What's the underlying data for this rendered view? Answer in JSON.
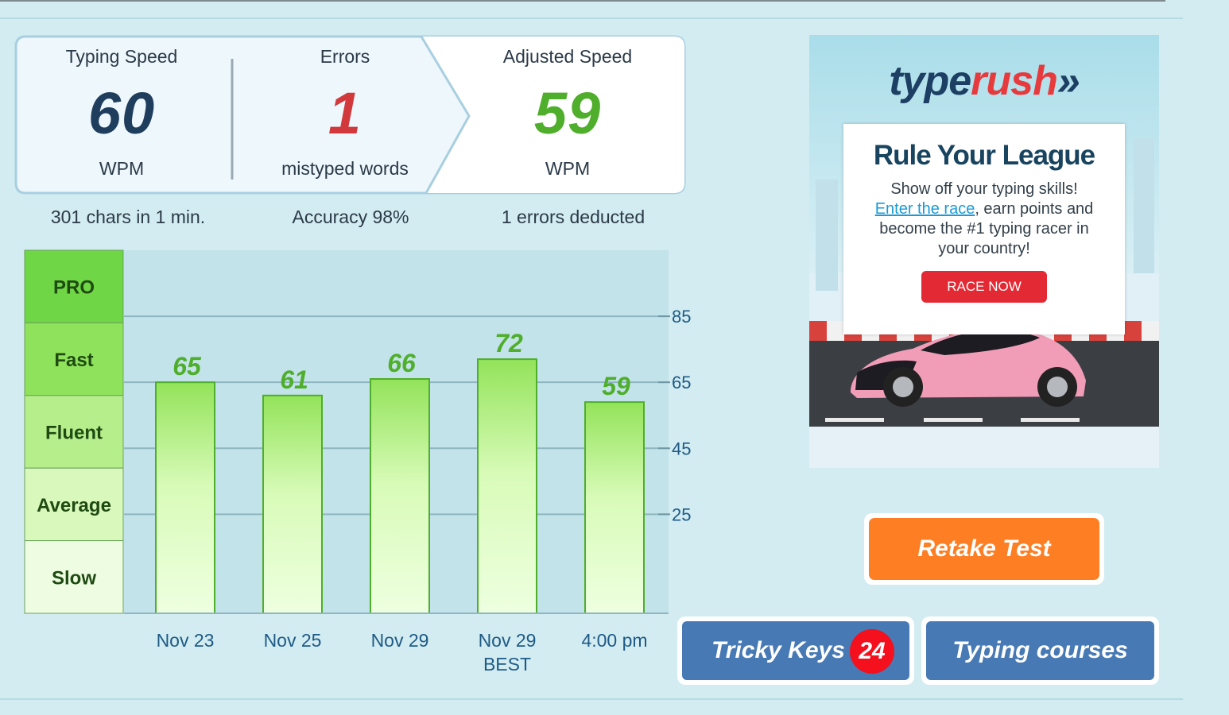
{
  "stats": {
    "typing_speed": {
      "label": "Typing Speed",
      "value": "60",
      "unit": "WPM",
      "color": "#1f3d5c"
    },
    "errors": {
      "label": "Errors",
      "value": "1",
      "unit": "mistyped words",
      "color": "#d1393d"
    },
    "adjusted_speed": {
      "label": "Adjusted Speed",
      "value": "59",
      "unit": "WPM",
      "color": "#4fae2b"
    }
  },
  "summary": {
    "chars": "301 chars in 1 min.",
    "accuracy": "Accuracy 98%",
    "deducted": "1 errors deducted"
  },
  "chart_data": {
    "type": "bar",
    "categories": [
      "Nov 23",
      "Nov 25",
      "Nov 29",
      "Nov 29",
      "4:00 pm"
    ],
    "category_sublabels": [
      "",
      "",
      "",
      "BEST",
      ""
    ],
    "values": [
      65,
      61,
      66,
      72,
      59
    ],
    "yticks": [
      25,
      45,
      65,
      85
    ],
    "ylim": [
      -5,
      105
    ],
    "levels": [
      "PRO",
      "Fast",
      "Fluent",
      "Average",
      "Slow"
    ],
    "colors": {
      "bar_fill_top": "#93e35a",
      "bar_fill_bottom": "#eeffe0",
      "bar_stroke": "#4fae2b",
      "value_label": "#4fae2b",
      "level_text": "#1f4a12"
    }
  },
  "ad": {
    "logo_part1": "type",
    "logo_part2": "rush",
    "logo_arrows": "»",
    "heading": "Rule Your League",
    "body_1": "Show off your typing skills!",
    "link": "Enter the race",
    "body_2": ", earn points and become the #1 typing racer in your country!",
    "cta": "RACE NOW"
  },
  "buttons": {
    "retake": "Retake Test",
    "tricky_keys": "Tricky Keys",
    "tricky_count": "24",
    "typing_courses": "Typing courses"
  }
}
